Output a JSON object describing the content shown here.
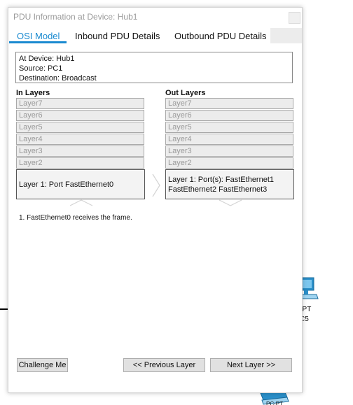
{
  "dialog": {
    "title": "PDU Information at Device: Hub1"
  },
  "tabs": [
    {
      "label": "OSI Model",
      "active": true
    },
    {
      "label": "Inbound PDU Details",
      "active": false
    },
    {
      "label": "Outbound PDU Details",
      "active": false
    }
  ],
  "info": {
    "device": "At Device: Hub1",
    "source": "Source: PC1",
    "destination": "Destination: Broadcast"
  },
  "in_layers": {
    "title": "In Layers",
    "items": [
      "Layer7",
      "Layer6",
      "Layer5",
      "Layer4",
      "Layer3",
      "Layer2"
    ],
    "layer1": "Layer 1: Port FastEthernet0"
  },
  "out_layers": {
    "title": "Out Layers",
    "items": [
      "Layer7",
      "Layer6",
      "Layer5",
      "Layer4",
      "Layer3",
      "Layer2"
    ],
    "layer1_line1": "Layer 1: Port(s): FastEthernet1",
    "layer1_line2": "FastEthernet2 FastEthernet3"
  },
  "steps": [
    "1. FastEthernet0 receives the frame."
  ],
  "buttons": {
    "challenge": "Challenge Me",
    "previous": "<< Previous Layer",
    "next": "Next Layer >>"
  },
  "background": {
    "device_label_1": "C-PT",
    "device_label_2": "C5",
    "device_label_3": "PC-PT"
  },
  "colors": {
    "accent": "#1a8ad0",
    "disabled_text": "#9a9a9a",
    "device_blue": "#2a8fc9"
  }
}
